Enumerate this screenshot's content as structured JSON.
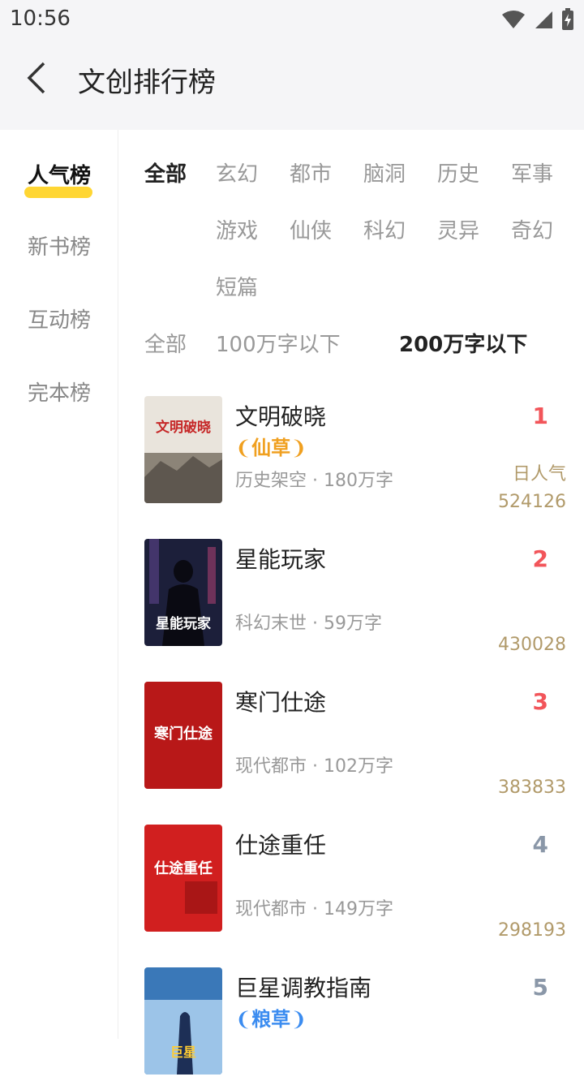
{
  "status": {
    "time": "10:56"
  },
  "header": {
    "title": "文创排行榜"
  },
  "sidebar": {
    "items": [
      {
        "label": "人气榜"
      },
      {
        "label": "新书榜"
      },
      {
        "label": "互动榜"
      },
      {
        "label": "完本榜"
      }
    ]
  },
  "genres": [
    "全部",
    "玄幻",
    "都市",
    "脑洞",
    "历史",
    "军事",
    "游戏",
    "仙侠",
    "科幻",
    "灵异",
    "奇幻",
    "短篇"
  ],
  "lengths": [
    "全部",
    "100万字以下",
    "200万字以下"
  ],
  "books": [
    {
      "title": "文明破晓",
      "badge": "仙草",
      "meta": "历史架空 · 180万字",
      "rank": "1",
      "pop_label": "日人气",
      "count": "524126",
      "cover_text": "文明破晓"
    },
    {
      "title": "星能玩家",
      "badge": "",
      "meta": "科幻末世 · 59万字",
      "rank": "2",
      "count": "430028",
      "cover_text": "星能玩家"
    },
    {
      "title": "寒门仕途",
      "badge": "",
      "meta": "现代都市 · 102万字",
      "rank": "3",
      "count": "383833",
      "cover_text": "寒门仕途"
    },
    {
      "title": "仕途重任",
      "badge": "",
      "meta": "现代都市 · 149万字",
      "rank": "4",
      "count": "298193",
      "cover_text": "仕途重任"
    },
    {
      "title": "巨星调教指南",
      "badge": "粮草",
      "meta": "",
      "rank": "5",
      "count": "",
      "cover_text": "巨星"
    }
  ],
  "colors": {
    "accent_yellow": "#ffd633",
    "rank_red": "#f2555a",
    "rank_gray": "#8a97a8",
    "gold": "#b19a6a",
    "badge_gold": "#f0a020",
    "badge_blue": "#3b8cf0"
  }
}
